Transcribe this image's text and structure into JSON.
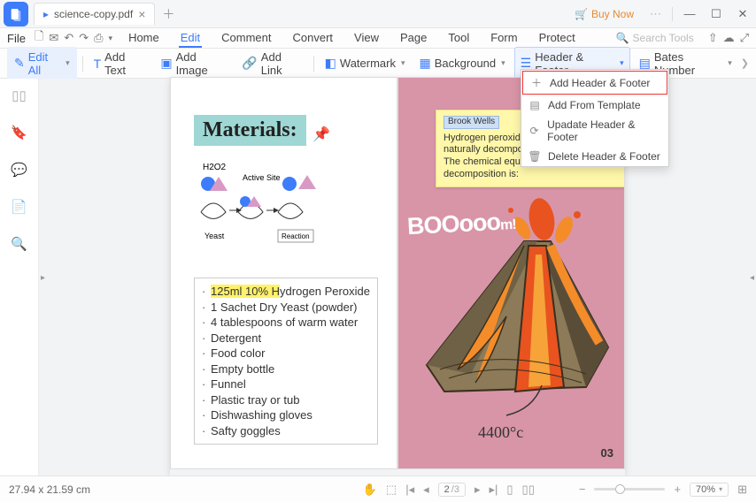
{
  "titlebar": {
    "filename": "science-copy.pdf",
    "buy_now": "Buy Now"
  },
  "menubar": {
    "file": "File",
    "tabs": [
      "Home",
      "Edit",
      "Comment",
      "Convert",
      "View",
      "Page",
      "Tool",
      "Form",
      "Protect"
    ],
    "active_tab": "Edit",
    "search_placeholder": "Search Tools"
  },
  "toolbar": {
    "edit_all": "Edit All",
    "add_text": "Add Text",
    "add_image": "Add Image",
    "add_link": "Add Link",
    "watermark": "Watermark",
    "background": "Background",
    "header_footer": "Header & Footer",
    "bates_number": "Bates Number"
  },
  "dropdown": {
    "add": "Add Header & Footer",
    "template": "Add From Template",
    "update": "Upadate Header & Footer",
    "delete": "Delete Header & Footer"
  },
  "page_left": {
    "heading": "Materials:",
    "diagram": {
      "h2o2": "H2O2",
      "active_site": "Active Site",
      "yeast": "Yeast",
      "reaction": "Reaction"
    },
    "highlight": "125ml 10% H",
    "line1_rest": "ydrogen Peroxide",
    "items": [
      "1 Sachet Dry Yeast (powder)",
      "4 tablespoons of warm water",
      "Detergent",
      "Food color",
      "Empty bottle",
      "Funnel",
      "Plastic tray or tub",
      "Dishwashing gloves",
      "Safty goggles"
    ]
  },
  "page_right": {
    "sticky_author": "Brook Wells",
    "sticky_l1": "Hydrogen peroxide molecules ar",
    "sticky_l2": "naturally decompose into water a",
    "sticky_l3": "The chemical equation for this decomposition is:",
    "boom": "BOOooo",
    "boom2": "m!",
    "temp": "4400°c",
    "page_num": "03"
  },
  "statusbar": {
    "dims": "27.94 x 21.59 cm",
    "page_current": "2",
    "page_total": "/3",
    "zoom": "70%"
  }
}
